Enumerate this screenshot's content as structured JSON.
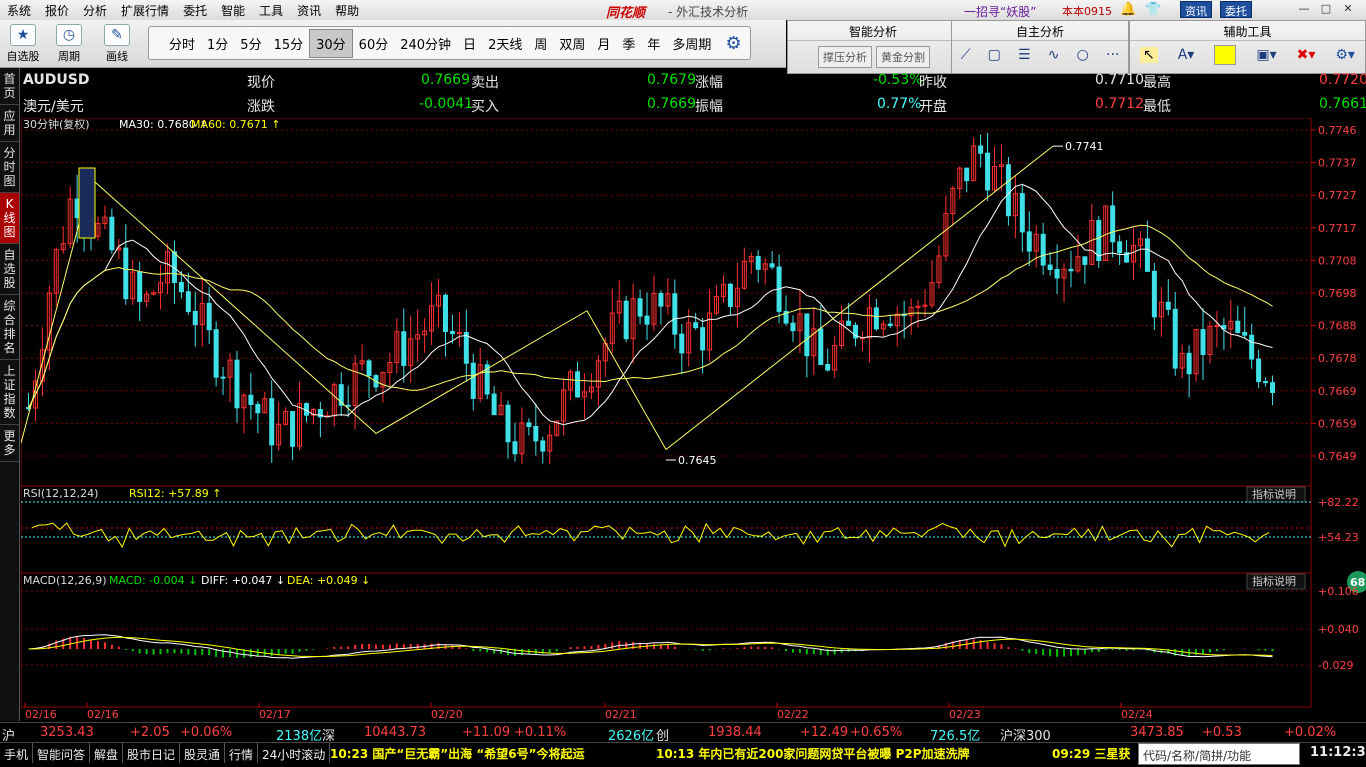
{
  "menu": [
    "系统",
    "报价",
    "分析",
    "扩展行情",
    "委托",
    "智能",
    "工具",
    "资讯",
    "帮助"
  ],
  "brand": "同花顺",
  "subtitle": "- 外汇技术分析",
  "slogan": "一招寻“妖股”",
  "version": "本本0915",
  "top_buttons": {
    "news": "资讯",
    "trade": "委托"
  },
  "tools": [
    {
      "label": "自选股",
      "icon": "star-icon"
    },
    {
      "label": "周期",
      "icon": "clock-icon"
    },
    {
      "label": "画线",
      "icon": "pen-icon"
    }
  ],
  "periods": [
    "分时",
    "1分",
    "5分",
    "15分",
    "30分",
    "60分",
    "240分钟",
    "日",
    "2天线",
    "周",
    "双周",
    "月",
    "季",
    "年",
    "多周期"
  ],
  "active_period": "30分",
  "smart_panel": {
    "title": "智能分析",
    "buttons": [
      "撑压分析",
      "黄金分割"
    ]
  },
  "self_panel": {
    "title": "自主分析"
  },
  "aux_panel": {
    "title": "辅助工具"
  },
  "side_tabs": [
    "首页",
    "应用",
    "分时图",
    "K线图",
    "自选股",
    "综合排名",
    "上证指数",
    "更多"
  ],
  "quote": {
    "code": "AUDUSD",
    "name": "澳元/美元",
    "labels": [
      "现价",
      "卖出",
      "涨幅",
      "昨收",
      "最高",
      "涨跌",
      "买入",
      "振幅",
      "开盘",
      "最低"
    ],
    "now": "0.7669",
    "sell": "0.7679",
    "change_pct": "-0.53%",
    "prev_close": "0.7710",
    "high": "0.7720",
    "change": "-0.0041",
    "buy": "0.7669",
    "amplitude": "0.77%",
    "open": "0.7712",
    "low": "0.7661"
  },
  "chart_data": [
    {
      "type": "candlestick",
      "title": "30分钟(复权)",
      "indicators": [
        {
          "name": "MA30",
          "value": "0.7680",
          "arrow": "↑"
        },
        {
          "name": "MA60",
          "value": "0.7671",
          "arrow": "↑"
        }
      ],
      "ylim": [
        0.7645,
        0.7746
      ],
      "y_ticks": [
        "0.7746",
        "0.7737",
        "0.7727",
        "0.7717",
        "0.7708",
        "0.7698",
        "0.7688",
        "0.7678",
        "0.7669",
        "0.7659",
        "0.7649"
      ],
      "annotations": [
        {
          "label": "0.7741",
          "value": 0.7741
        },
        {
          "label": "0.7645",
          "value": 0.7645
        }
      ],
      "x_labels": [
        "02/16",
        "02/16",
        "02/17",
        "02/20",
        "02/21",
        "02/22",
        "02/23",
        "02/24"
      ],
      "zigzag": [
        0.7649,
        0.7731,
        0.7652,
        0.769,
        0.7647,
        0.7741
      ],
      "close_path": [
        0.766,
        0.77,
        0.7728,
        0.7715,
        0.7705,
        0.769,
        0.7702,
        0.7695,
        0.768,
        0.767,
        0.766,
        0.7652,
        0.7656,
        0.7662,
        0.7668,
        0.7672,
        0.7675,
        0.7682,
        0.7688,
        0.768,
        0.7665,
        0.7652,
        0.7648,
        0.7655,
        0.7665,
        0.7675,
        0.7685,
        0.7692,
        0.769,
        0.7682,
        0.7684,
        0.7695,
        0.7708,
        0.77,
        0.7688,
        0.7672,
        0.768,
        0.769,
        0.7692,
        0.7688,
        0.77,
        0.7728,
        0.774,
        0.7728,
        0.7715,
        0.771,
        0.7706,
        0.7712,
        0.7716,
        0.7708,
        0.769,
        0.7672,
        0.768,
        0.7684,
        0.7676,
        0.767
      ]
    },
    {
      "type": "line",
      "title": "RSI(12,12,24)",
      "indicators": [
        {
          "name": "RSI12",
          "value": "+57.89",
          "arrow": "↑"
        }
      ],
      "y_ticks": [
        "+82.22",
        "+54.23"
      ],
      "button": "指标说明"
    },
    {
      "type": "bar",
      "title": "MACD(12,26,9)",
      "indicators": [
        {
          "name": "MACD",
          "value": "-0.004",
          "arrow": "↓"
        },
        {
          "name": "DIFF",
          "value": "+0.047",
          "arrow": "↓"
        },
        {
          "name": "DEA",
          "value": "+0.049",
          "arrow": "↓"
        }
      ],
      "y_ticks": [
        "+0.106",
        "+0.040",
        "-0.029"
      ],
      "button": "指标说明",
      "badge": "68"
    }
  ],
  "footer": {
    "sh_label": "沪",
    "sh_index": "3253.43",
    "sh_chg": "+2.05",
    "sh_pct": "+0.06%",
    "sh_amt": "2138亿",
    "sz_label": "深",
    "sz_index": "10443.73",
    "sz_chg": "+11.09",
    "sz_pct": "+0.11%",
    "sz_amt": "2626亿",
    "cy_label": "创",
    "cy_index": "1938.44",
    "cy_chg": "+12.49",
    "cy_pct": "+0.65%",
    "cy_amt": "726.5亿",
    "hs_label": "沪深300",
    "hs_index": "3473.85",
    "hs_chg": "+0.53",
    "hs_pct": "+0.02%"
  },
  "status_tabs": [
    "手机",
    "智能问答",
    "解盘",
    "股市日记",
    "股灵通",
    "行情",
    "24小时滚动"
  ],
  "news": [
    "10:23 国产“巨无霸”出海 “希望6号”今将起运",
    "10:13 年内已有近200家问题网贷平台被曝 P2P加速洗牌",
    "09:29 三星获"
  ],
  "search_placeholder": "代码/名称/简拼/功能",
  "clock": "11:12:34",
  "colors": {
    "up": "#ff3030",
    "down": "#40e0e8",
    "ma": "#ffffff",
    "ma2": "#ffff66",
    "grid": "#7a0000",
    "bar_green": "#00c000"
  }
}
